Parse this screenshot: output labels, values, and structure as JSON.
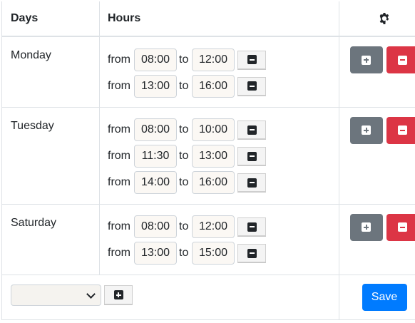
{
  "header": {
    "days_label": "Days",
    "hours_label": "Hours",
    "settings_icon": "gear-icon"
  },
  "labels": {
    "from": "from",
    "to": "to"
  },
  "days": [
    {
      "name": "Monday",
      "ranges": [
        {
          "from": "08:00",
          "to": "12:00"
        },
        {
          "from": "13:00",
          "to": "16:00"
        }
      ]
    },
    {
      "name": "Tuesday",
      "ranges": [
        {
          "from": "08:00",
          "to": "10:00"
        },
        {
          "from": "11:30",
          "to": "13:00"
        },
        {
          "from": "14:00",
          "to": "16:00"
        }
      ]
    },
    {
      "name": "Saturday",
      "ranges": [
        {
          "from": "08:00",
          "to": "12:00"
        },
        {
          "from": "13:00",
          "to": "15:00"
        }
      ]
    }
  ],
  "footer": {
    "day_select_value": "",
    "save_label": "Save"
  },
  "colors": {
    "add_button": "#6c757d",
    "delete_button": "#dc3545",
    "save_button": "#007bff"
  }
}
